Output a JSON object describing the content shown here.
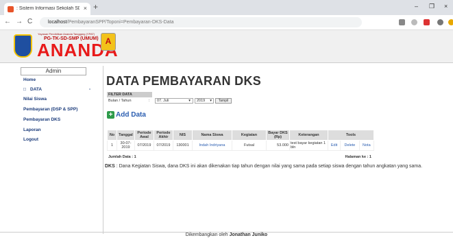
{
  "browser": {
    "tab_title": ": Sistem Informasi Sekolah SD",
    "tab_close": "×",
    "new_tab": "+",
    "url_host": "localhost",
    "url_path": "/PembayaranSPP/Toponi=Pembayaran-DKS-Data",
    "back": "←",
    "forward": "→",
    "reload": "C",
    "minimize": "–",
    "maximize": "❐",
    "close": "×"
  },
  "header": {
    "foundation": "Yayasan Pendidikan Ananda Tanggang (YPAT)",
    "unit": "PG-TK-SD-SMP (UMUM)",
    "brand": "ANANDA",
    "logo_letter": "A"
  },
  "sidebar": {
    "admin_label": "Admin",
    "items": [
      {
        "label": "Home"
      },
      {
        "label": "DATA"
      },
      {
        "label": "Nilai Siswa"
      },
      {
        "label": "Pembayaran (DSP & SPP)"
      },
      {
        "label": "Pembayaran DKS"
      },
      {
        "label": "Laporan"
      },
      {
        "label": "Logout"
      }
    ]
  },
  "main": {
    "title": "DATA PEMBAYARAN DKS",
    "filter": {
      "header": "FILTER DATA",
      "label": "Bulan / Tahun",
      "colon": ":",
      "month": "07. Juli",
      "year": "2019",
      "button": "Tampil"
    },
    "add_button": "Add Data",
    "table": {
      "headers": [
        "No",
        "Tanggal",
        "Periode Awal",
        "Periode Akhir",
        "NIS",
        "Nama Siswa",
        "Kegiatan",
        "Bayar DKS (Rp)",
        "Keterangan",
        "Tools"
      ],
      "rows": [
        {
          "no": "1",
          "tanggal": "30-07-2019",
          "awal": "07/2019",
          "akhir": "07/2019",
          "nis": "130001",
          "nama": "Indah Indriyana",
          "kegiatan": "Futsal",
          "bayar": "53.000",
          "keterangan": "test bayar kegiatan 1 bln",
          "tools": [
            "Edit",
            "Delete",
            "Nota"
          ]
        }
      ],
      "footer_left": "Jumlah Data : 1",
      "footer_right": "Halaman ke : 1"
    },
    "note_bold": "DKS",
    "note_text": " : Dana Kegiatan Siswa, dana DKS ini akan dikenakan tiap tahun dengan nilai yang sama pada setiap siswa dengan tahun angkatan yang sama."
  },
  "footer": {
    "prefix": "Dikembangkan oleh ",
    "author": "Jonathan Juniko"
  }
}
